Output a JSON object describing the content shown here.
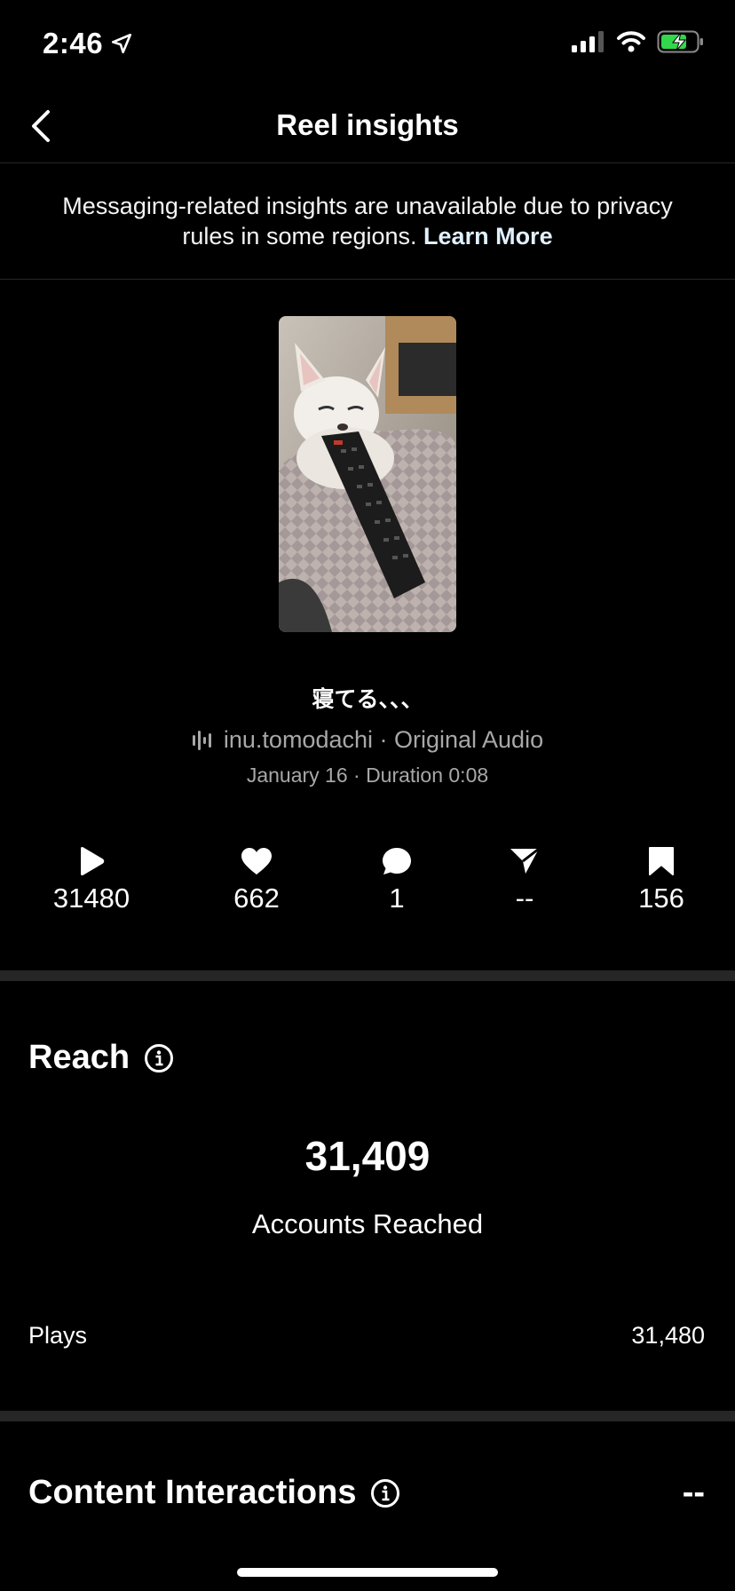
{
  "status": {
    "time": "2:46"
  },
  "nav": {
    "title": "Reel insights"
  },
  "notice": {
    "text": "Messaging-related insights are unavailable due to privacy rules in some regions.",
    "link": "Learn More"
  },
  "reel": {
    "caption": "寝てる、、、",
    "audio": "inu.tomodachi · Original Audio",
    "meta": "January 16 · Duration 0:08"
  },
  "stats": {
    "plays": "31480",
    "likes": "662",
    "comments": "1",
    "shares": "--",
    "saves": "156"
  },
  "reach": {
    "title": "Reach",
    "accounts_reached": "31,409",
    "accounts_reached_label": "Accounts Reached",
    "plays_label": "Plays",
    "plays_value": "31,480"
  },
  "content_interactions": {
    "title": "Content Interactions",
    "value": "--"
  }
}
